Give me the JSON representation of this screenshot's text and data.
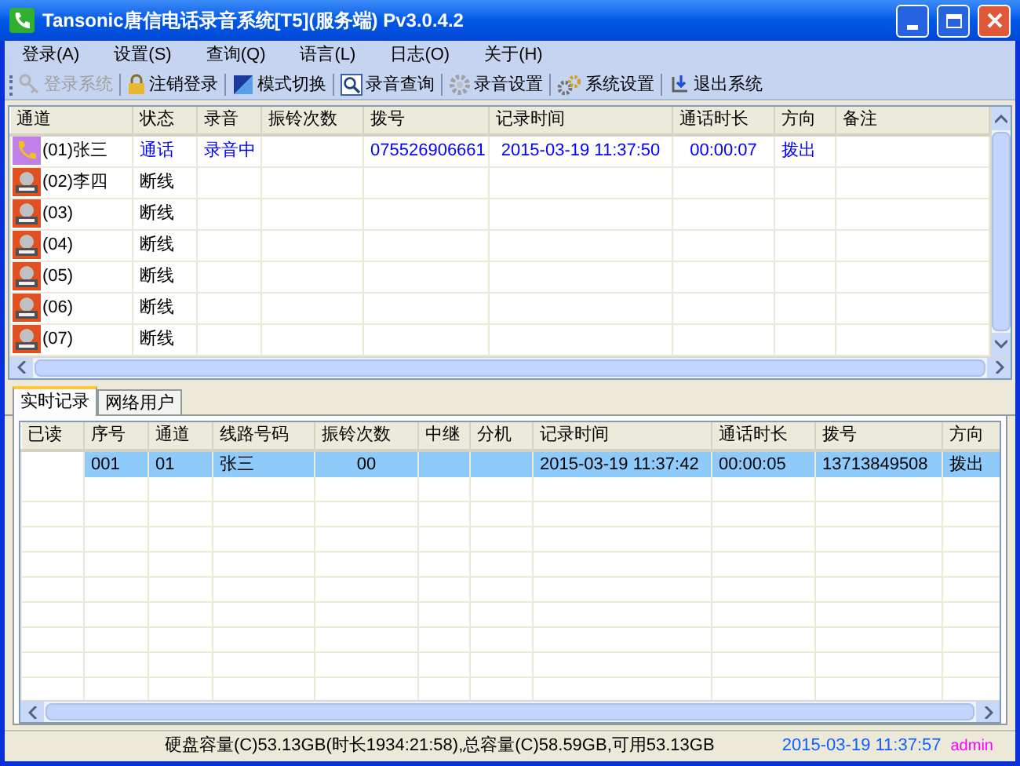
{
  "window": {
    "title": "Tansonic唐信电话录音系统[T5](服务端) Pv3.0.4.2"
  },
  "menu": [
    "登录(A)",
    "设置(S)",
    "查询(Q)",
    "语言(L)",
    "日志(O)",
    "关于(H)"
  ],
  "toolbar": [
    {
      "label": "登录系统",
      "kind": "key",
      "disabled": true
    },
    {
      "label": "注销登录",
      "kind": "lock",
      "disabled": false
    },
    {
      "label": "模式切换",
      "kind": "mode",
      "disabled": false
    },
    {
      "label": "录音查询",
      "kind": "search",
      "disabled": false
    },
    {
      "label": "录音设置",
      "kind": "gear",
      "disabled": false
    },
    {
      "label": "系统设置",
      "kind": "gears",
      "disabled": false
    },
    {
      "label": "退出系统",
      "kind": "exit",
      "disabled": false
    }
  ],
  "channels": {
    "columns": [
      "通道",
      "状态",
      "录音",
      "振铃次数",
      "拨号",
      "记录时间",
      "通话时长",
      "方向",
      "备注"
    ],
    "rows": [
      {
        "kind": "call",
        "cells": [
          "(01)张三",
          "通话",
          "录音中",
          "",
          "075526906661",
          "2015-03-19 11:37:50",
          "00:00:07",
          "拨出",
          ""
        ]
      },
      {
        "kind": "offline",
        "cells": [
          "(02)李四",
          "断线",
          "",
          "",
          "",
          "",
          "",
          "",
          ""
        ]
      },
      {
        "kind": "offline",
        "cells": [
          "(03)",
          "断线",
          "",
          "",
          "",
          "",
          "",
          "",
          ""
        ]
      },
      {
        "kind": "offline",
        "cells": [
          "(04)",
          "断线",
          "",
          "",
          "",
          "",
          "",
          "",
          ""
        ]
      },
      {
        "kind": "offline",
        "cells": [
          "(05)",
          "断线",
          "",
          "",
          "",
          "",
          "",
          "",
          ""
        ]
      },
      {
        "kind": "offline",
        "cells": [
          "(06)",
          "断线",
          "",
          "",
          "",
          "",
          "",
          "",
          ""
        ]
      },
      {
        "kind": "offline",
        "cells": [
          "(07)",
          "断线",
          "",
          "",
          "",
          "",
          "",
          "",
          ""
        ]
      }
    ]
  },
  "tabs": [
    {
      "label": "实时记录",
      "selected": true
    },
    {
      "label": "网络用户",
      "selected": false
    }
  ],
  "records": {
    "columns": [
      "已读",
      "序号",
      "通道",
      "线路号码",
      "振铃次数",
      "中继",
      "分机",
      "记录时间",
      "通话时长",
      "拨号",
      "方向"
    ],
    "rows": [
      {
        "selected": true,
        "cells": [
          "",
          "001",
          "01",
          "张三",
          "00",
          "",
          "",
          "2015-03-19 11:37:42",
          "00:00:05",
          "13713849508",
          "拨出"
        ]
      }
    ]
  },
  "status_bar": {
    "disk": "硬盘容量(C)53.13GB(时长1934:21:58),总容量(C)58.59GB,可用53.13GB",
    "datetime": "2015-03-19 11:37:57",
    "user": "admin"
  }
}
